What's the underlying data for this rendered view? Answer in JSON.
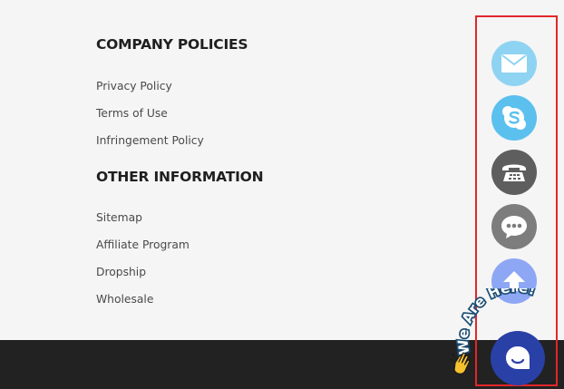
{
  "sections": [
    {
      "title": "COMPANY POLICIES",
      "links": [
        "Privacy Policy",
        "Terms of Use",
        "Infringement Policy"
      ]
    },
    {
      "title": "OTHER INFORMATION",
      "links": [
        "Sitemap",
        "Affiliate Program",
        "Dropship",
        "Wholesale"
      ]
    }
  ],
  "contact_widget": {
    "buttons": [
      {
        "icon": "mail-icon",
        "color": "#8fd3f2"
      },
      {
        "icon": "skype-icon",
        "color": "#5bc0ee"
      },
      {
        "icon": "telephone-icon",
        "color": "#5e5e5e"
      },
      {
        "icon": "chat-bubble-icon",
        "color": "#7d7d7d"
      },
      {
        "icon": "arrow-up-icon",
        "color": "#8ea7f5"
      }
    ],
    "livechat_label": "We Are Here!",
    "livechat_color": "#2940a6",
    "highlight_color": "#e3262a"
  }
}
